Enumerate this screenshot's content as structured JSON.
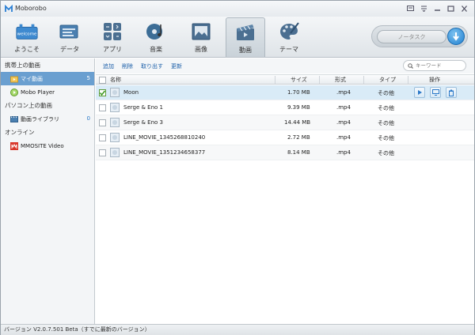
{
  "app": {
    "title": "Moborobo"
  },
  "toolbar": {
    "tools": [
      {
        "label": "ようこそ",
        "icon": "welcome-icon"
      },
      {
        "label": "データ",
        "icon": "data-icon"
      },
      {
        "label": "アプリ",
        "icon": "apps-icon"
      },
      {
        "label": "音楽",
        "icon": "music-icon"
      },
      {
        "label": "画像",
        "icon": "image-icon"
      },
      {
        "label": "動画",
        "icon": "video-icon"
      },
      {
        "label": "テーマ",
        "icon": "theme-icon"
      }
    ],
    "active_tool": "動画",
    "sync_label": "ノータスク",
    "welcome_badge": "welcome"
  },
  "sidebar": {
    "sections": [
      {
        "title": "携帯上の動画"
      },
      {
        "title": "パソコン上の動画"
      },
      {
        "title": "オンライン"
      }
    ],
    "items": [
      {
        "label": "マイ動画",
        "count": "5"
      },
      {
        "label": "Mobo Player",
        "count": ""
      },
      {
        "label": "動画ライブラリ",
        "count": "0"
      },
      {
        "label": "MMOSITE Video",
        "count": ""
      }
    ]
  },
  "actions": {
    "add": "追加",
    "delete": "削除",
    "export": "取り出す",
    "refresh": "更新",
    "search_placeholder": "キーワード"
  },
  "table": {
    "columns": [
      "名称",
      "サイズ",
      "形式",
      "タイプ",
      "操作"
    ],
    "rows": [
      {
        "name": "Moon",
        "size": "1.70 MB",
        "format": ".mp4",
        "type": "その他",
        "checked": true
      },
      {
        "name": "Serge & Eno 1",
        "size": "9.39 MB",
        "format": ".mp4",
        "type": "その他",
        "checked": false
      },
      {
        "name": "Serge & Eno 3",
        "size": "14.44 MB",
        "format": ".mp4",
        "type": "その他",
        "checked": false
      },
      {
        "name": "LINE_MOVIE_1345268810240",
        "size": "2.72 MB",
        "format": ".mp4",
        "type": "その他",
        "checked": false
      },
      {
        "name": "LINE_MOVIE_1351234658377",
        "size": "8.14 MB",
        "format": ".mp4",
        "type": "その他",
        "checked": false
      }
    ]
  },
  "status": {
    "text": "バージョン V2.0.7.501 Beta（すでに最新のバージョン）"
  },
  "colors": {
    "accent": "#6a9fd0",
    "link": "#1a5ea8",
    "selected_row": "#d9ebf7"
  }
}
